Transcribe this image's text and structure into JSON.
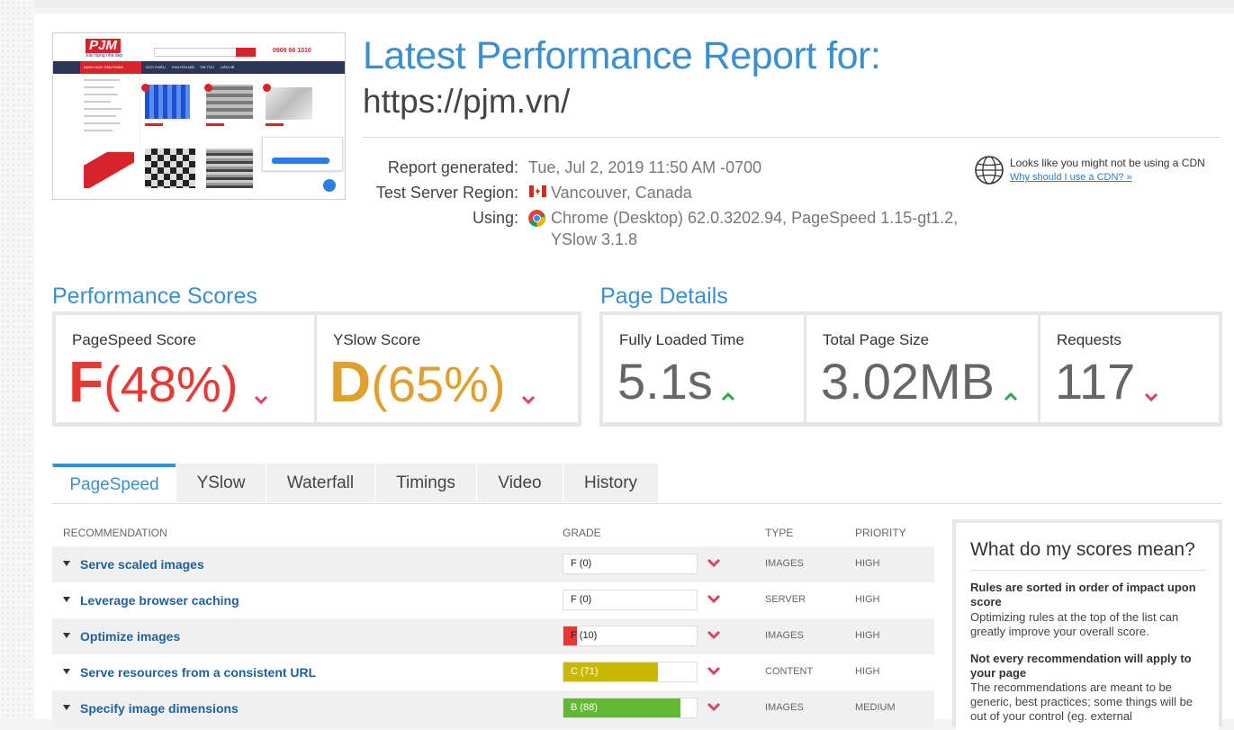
{
  "header": {
    "title": "Latest Performance Report for:",
    "url": "https://pjm.vn/"
  },
  "meta": {
    "generated_label": "Report generated:",
    "generated_value": "Tue, Jul 2, 2019 11:50 AM -0700",
    "region_label": "Test Server Region:",
    "region_value": "Vancouver, Canada",
    "using_label": "Using:",
    "using_value_line1": "Chrome (Desktop) 62.0.3202.94, PageSpeed 1.15-gt1.2,",
    "using_value_line2": "YSlow 3.1.8"
  },
  "cdn": {
    "text": "Looks like you might not be using a CDN",
    "link": "Why should I use a CDN? »"
  },
  "thumbnail": {
    "logo": "PJM",
    "tagline": "Xây dựng nhà đẹp",
    "hotline": "0909 66 1010",
    "nav": [
      "DANH MỤC SẢN PHẨM",
      "GIỚI THIỆU",
      "KHUYẾN MÃI",
      "TIN TỨC",
      "LIÊN HỆ"
    ]
  },
  "performance": {
    "section_title": "Performance Scores",
    "pagespeed_label": "PageSpeed Score",
    "pagespeed_grade": "F",
    "pagespeed_pct": "(48%)",
    "yslow_label": "YSlow Score",
    "yslow_grade": "D",
    "yslow_pct": "(65%)"
  },
  "details": {
    "section_title": "Page Details",
    "loaded_label": "Fully Loaded Time",
    "loaded_value": "5.1s",
    "size_label": "Total Page Size",
    "size_value": "3.02MB",
    "requests_label": "Requests",
    "requests_value": "117"
  },
  "tabs": [
    "PageSpeed",
    "YSlow",
    "Waterfall",
    "Timings",
    "Video",
    "History"
  ],
  "table": {
    "headers": {
      "recommendation": "RECOMMENDATION",
      "grade": "GRADE",
      "type": "TYPE",
      "priority": "PRIORITY"
    },
    "rows": [
      {
        "name": "Serve scaled images",
        "grade": "F (0)",
        "score": 0,
        "color": "#e53935",
        "type": "IMAGES",
        "priority": "HIGH"
      },
      {
        "name": "Leverage browser caching",
        "grade": "F (0)",
        "score": 0,
        "color": "#e53935",
        "type": "SERVER",
        "priority": "HIGH"
      },
      {
        "name": "Optimize images",
        "grade": "F (10)",
        "score": 10,
        "color": "#e53935",
        "type": "IMAGES",
        "priority": "HIGH"
      },
      {
        "name": "Serve resources from a consistent URL",
        "grade": "C (71)",
        "score": 71,
        "color": "#c9b800",
        "type": "CONTENT",
        "priority": "HIGH"
      },
      {
        "name": "Specify image dimensions",
        "grade": "B (88)",
        "score": 88,
        "color": "#62b832",
        "type": "IMAGES",
        "priority": "MEDIUM"
      }
    ]
  },
  "sidebar": {
    "title": "What do my scores mean?",
    "b1": "Rules are sorted in order of impact upon score",
    "t1": "Optimizing rules at the top of the list can greatly improve your overall score.",
    "b2": "Not every recommendation will apply to your page",
    "t2": "The recommendations are meant to be generic, best practices; some things will be out of your control (eg. external"
  },
  "colors": {
    "accent": "#3a8fd0",
    "grade_f": "#e53935",
    "grade_d": "#e0a030",
    "trend_up": "#2ea44f",
    "trend_down": "#e04060"
  }
}
